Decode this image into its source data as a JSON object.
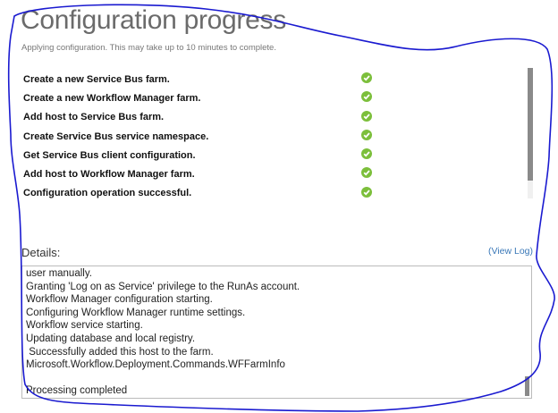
{
  "header": {
    "title": "Configuration progress",
    "subtitle": "Applying configuration. This may take up to 10 minutes to complete."
  },
  "steps": [
    {
      "label": "Create a new Service Bus farm.",
      "status": "check-circle-icon"
    },
    {
      "label": "Create a new Workflow Manager farm.",
      "status": "check-circle-icon"
    },
    {
      "label": "Add host to Service Bus farm.",
      "status": "check-circle-icon"
    },
    {
      "label": "Create Service Bus service namespace.",
      "status": "check-circle-icon"
    },
    {
      "label": "Get Service Bus client configuration.",
      "status": "check-circle-icon"
    },
    {
      "label": "Add host to Workflow Manager farm.",
      "status": "check-circle-icon"
    },
    {
      "label": "Configuration operation successful.",
      "status": "check-circle-icon"
    }
  ],
  "details": {
    "label": "Details:",
    "view_log": "(View Log)",
    "lines": [
      "user manually.",
      "Granting 'Log on as Service' privilege to the RunAs account.",
      "Workflow Manager configuration starting.",
      "Configuring Workflow Manager runtime settings.",
      "Workflow service starting.",
      "Updating database and local registry.",
      " Successfully added this host to the farm.",
      "Microsoft.Workflow.Deployment.Commands.WFFarmInfo",
      "",
      "Processing completed"
    ]
  },
  "colors": {
    "success": "#7cbf3b",
    "link": "#3a78b8",
    "annotation": "#1a1ad0"
  }
}
